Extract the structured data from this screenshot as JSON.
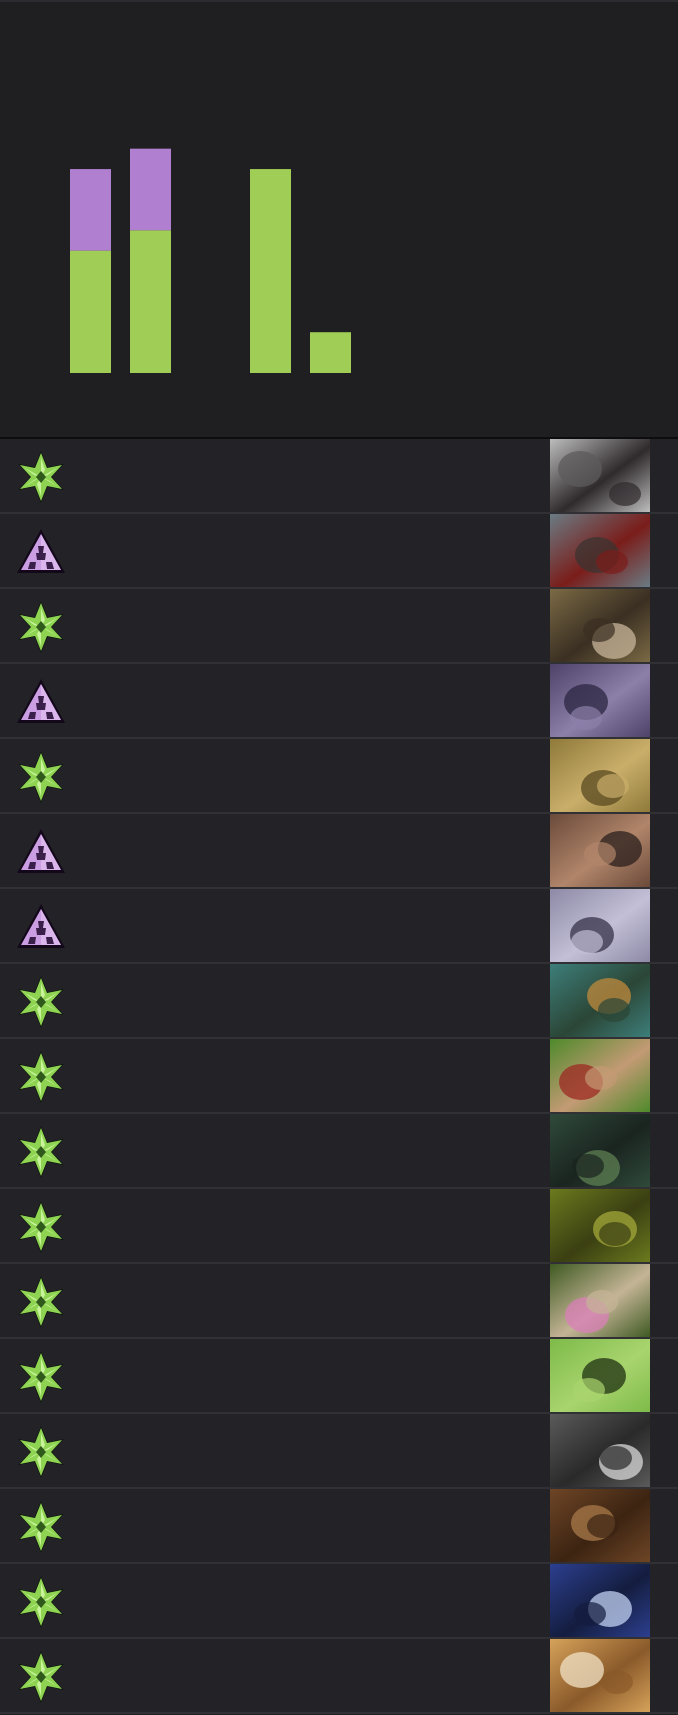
{
  "colors": {
    "page_background": "#202023",
    "chart_background": "#1f1f22",
    "row_background": "#232327",
    "row_divider": "#303035",
    "green": "#9fcd55",
    "purple": "#b07fcf"
  },
  "chart_data": {
    "type": "bar",
    "stacked": true,
    "categories": [
      "",
      "",
      "",
      "",
      "",
      ""
    ],
    "series": [
      {
        "color": "#9fcd55",
        "values": [
          6,
          7,
          0,
          10,
          2,
          0
        ]
      },
      {
        "color": "#b07fcf",
        "values": [
          4,
          4,
          0,
          0,
          0,
          0
        ]
      }
    ],
    "ylim": [
      0,
      14
    ],
    "grid": false,
    "legend": "none",
    "title": "",
    "xlabel": "",
    "ylabel": ""
  },
  "cards": [
    {
      "faction": "green",
      "icon": "green-leaf-icon",
      "art": "rat-art",
      "art_colors": [
        "#bdbdbd",
        "#5e5b5c",
        "#2f2a2c"
      ]
    },
    {
      "faction": "purple",
      "icon": "purple-pyramid-icon",
      "art": "wolf-art",
      "art_colors": [
        "#6a7c84",
        "#3b3432",
        "#7a1d1a"
      ]
    },
    {
      "faction": "green",
      "icon": "green-leaf-icon",
      "art": "giant-rat-art",
      "art_colors": [
        "#7b6a45",
        "#c8b59a",
        "#3a2f22"
      ]
    },
    {
      "faction": "purple",
      "icon": "purple-pyramid-icon",
      "art": "mech-art",
      "art_colors": [
        "#4d4268",
        "#2b2540",
        "#8c7fa8"
      ]
    },
    {
      "faction": "green",
      "icon": "green-leaf-icon",
      "art": "idol-art",
      "art_colors": [
        "#8f7a3a",
        "#5a4a22",
        "#c9ae6a"
      ]
    },
    {
      "faction": "purple",
      "icon": "purple-pyramid-icon",
      "art": "hunter-art",
      "art_colors": [
        "#6b4a3a",
        "#2a1f1c",
        "#b0856a"
      ]
    },
    {
      "faction": "purple",
      "icon": "purple-pyramid-icon",
      "art": "knight-art",
      "art_colors": [
        "#8e8aa6",
        "#36324a",
        "#c2bfd6"
      ]
    },
    {
      "faction": "green",
      "icon": "green-leaf-icon",
      "art": "druids-art",
      "art_colors": [
        "#3d7e7a",
        "#c08a3c",
        "#2b4636"
      ]
    },
    {
      "faction": "green",
      "icon": "green-leaf-icon",
      "art": "red-hood-art",
      "art_colors": [
        "#4e8a2a",
        "#9c2a23",
        "#c39a74"
      ]
    },
    {
      "faction": "green",
      "icon": "green-leaf-icon",
      "art": "forest-spirit-art",
      "art_colors": [
        "#2f4a3a",
        "#5d7f52",
        "#1a2420"
      ]
    },
    {
      "faction": "green",
      "icon": "green-leaf-icon",
      "art": "swamp-art",
      "art_colors": [
        "#6b7a1e",
        "#a3a83a",
        "#3b3f12"
      ]
    },
    {
      "faction": "green",
      "icon": "green-leaf-icon",
      "art": "skull-flower-art",
      "art_colors": [
        "#3f5a22",
        "#d97fb8",
        "#c4b496"
      ]
    },
    {
      "faction": "green",
      "icon": "green-leaf-icon",
      "art": "silhouette-art",
      "art_colors": [
        "#7dbb4a",
        "#1f3012",
        "#a9d46e"
      ]
    },
    {
      "faction": "green",
      "icon": "green-leaf-icon",
      "art": "beast-art",
      "art_colors": [
        "#5a5a5a",
        "#d9d9d9",
        "#2a2a2a"
      ]
    },
    {
      "faction": "green",
      "icon": "green-leaf-icon",
      "art": "monkeys-art",
      "art_colors": [
        "#6e4526",
        "#a87a4a",
        "#3c2412"
      ]
    },
    {
      "faction": "green",
      "icon": "green-leaf-icon",
      "art": "storm-art",
      "art_colors": [
        "#2c3f8f",
        "#c2d2f2",
        "#141d3f"
      ]
    },
    {
      "faction": "green",
      "icon": "green-leaf-icon",
      "art": "yeti-art",
      "art_colors": [
        "#d6a25a",
        "#f1e2c6",
        "#8a5a2a"
      ]
    }
  ]
}
